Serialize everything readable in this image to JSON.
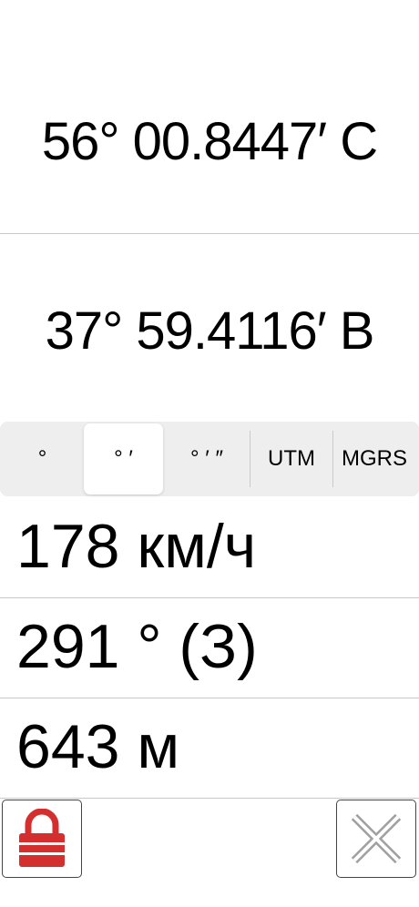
{
  "coordinates": {
    "latitude": "56° 00.8447′ С",
    "longitude": "37° 59.4116′ В"
  },
  "format_selector": {
    "options": [
      "°",
      "° ′",
      "° ′ ″",
      "UTM",
      "MGRS"
    ],
    "selected_index": 1
  },
  "stats": {
    "speed": "178 км/ч",
    "heading": "291 ° (З)",
    "altitude": "643 м"
  },
  "colors": {
    "lock_red": "#d32f2f",
    "close_gray": "#a0a0a0"
  },
  "icons": {
    "lock": "lock-icon",
    "close": "close-icon"
  }
}
